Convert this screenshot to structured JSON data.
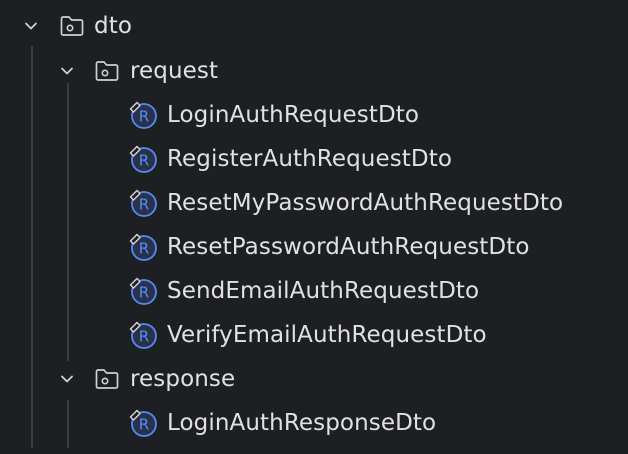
{
  "tree": {
    "root": {
      "label": "dto",
      "expanded": true,
      "icon": "folder-icon"
    },
    "request": {
      "label": "request",
      "expanded": true,
      "icon": "folder-icon",
      "items": [
        {
          "label": "LoginAuthRequestDto",
          "icon": "record-class-icon"
        },
        {
          "label": "RegisterAuthRequestDto",
          "icon": "record-class-icon"
        },
        {
          "label": "ResetMyPasswordAuthRequestDto",
          "icon": "record-class-icon"
        },
        {
          "label": "ResetPasswordAuthRequestDto",
          "icon": "record-class-icon"
        },
        {
          "label": "SendEmailAuthRequestDto",
          "icon": "record-class-icon"
        },
        {
          "label": "VerifyEmailAuthRequestDto",
          "icon": "record-class-icon"
        }
      ]
    },
    "response": {
      "label": "response",
      "expanded": true,
      "icon": "folder-icon",
      "items": [
        {
          "label": "LoginAuthResponseDto",
          "icon": "record-class-icon"
        }
      ]
    }
  },
  "colors": {
    "background": "#1e1f22",
    "text": "#dfe1e5",
    "icon_stroke": "#ced0d6",
    "record_blue": "#548af7",
    "guide": "#3b3d41"
  }
}
